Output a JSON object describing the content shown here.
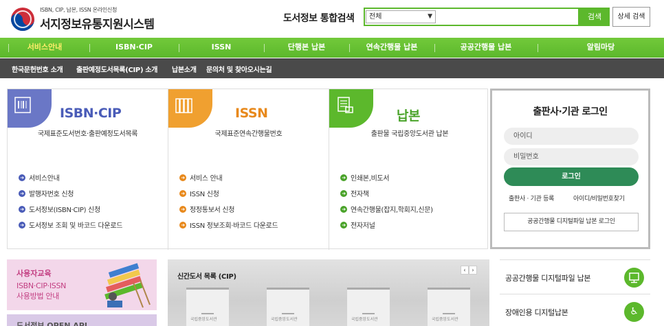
{
  "header": {
    "logo_sub": "ISBN, CIP, 납본, ISSN 온라인신청",
    "logo_main": "서지정보유통지원시스템",
    "search_title": "도서정보 통합검색",
    "search_select_value": "전체",
    "search_button": "검색",
    "advanced_search_button": "상세 검색"
  },
  "gnb": {
    "items": [
      {
        "label": "서비스안내"
      },
      {
        "label": "ISBN·CIP"
      },
      {
        "label": "ISSN"
      },
      {
        "label": "단행본 납본"
      },
      {
        "label": "연속간행물 납본"
      },
      {
        "label": "공공간행물 납본"
      },
      {
        "label": "알림마당"
      }
    ]
  },
  "snb": {
    "items": [
      {
        "label": "한국문헌번호 소개"
      },
      {
        "label": "출판예정도서목록(CIP) 소개"
      },
      {
        "label": "납본소개"
      },
      {
        "label": "문의처 및 찾아오시는길"
      }
    ]
  },
  "panels": [
    {
      "title": "ISBN·CIP",
      "desc": "국제표준도서번호·출판예정도서목록",
      "color": "#4a5cb8",
      "corner": "#6a77c6",
      "links": [
        "서비스안내",
        "발행자번호 신청",
        "도서정보(ISBN·CIP) 신청",
        "도서정보 조회 및 바코드 다운로드"
      ]
    },
    {
      "title": "ISSN",
      "desc": "국제표준연속간행물번호",
      "color": "#e8891c",
      "corner": "#f0a030",
      "links": [
        "서비스 안내",
        "ISSN 신청",
        "정정통보서 신청",
        "ISSN 정보조회·바코드 다운로드"
      ]
    },
    {
      "title": "납본",
      "desc": "출판물 국립중앙도서관 납본",
      "color": "#4aa32a",
      "corner": "#5cb82c",
      "links": [
        "인쇄본,비도서",
        "전자책",
        "연속간행물(잡지,학회지,신문)",
        "전자저널"
      ]
    }
  ],
  "login": {
    "title": "출판사·기관 로그인",
    "id_placeholder": "아이디",
    "pw_placeholder": "비밀번호",
    "login_button": "로그인",
    "register_link": "출판사 · 기관 등록",
    "find_link": "아이디/비밀번호찾기",
    "digital_button": "공공간행물 디지털파일 납본 로그인"
  },
  "education": {
    "title": "사용자교육",
    "desc_line1": "ISBN·CIP·ISSN",
    "desc_line2": "사용방법 안내"
  },
  "openapi": {
    "label": "도서정보 OPEN API"
  },
  "newbooks": {
    "title": "신간도서 목록 (CIP)",
    "book_label": "국립중앙도서관"
  },
  "side_links": [
    {
      "label": "공공간행물 디지털파일 납본",
      "icon": "monitor-icon"
    },
    {
      "label": "장애인용 디지털납본",
      "icon": "wheelchair-icon"
    }
  ]
}
